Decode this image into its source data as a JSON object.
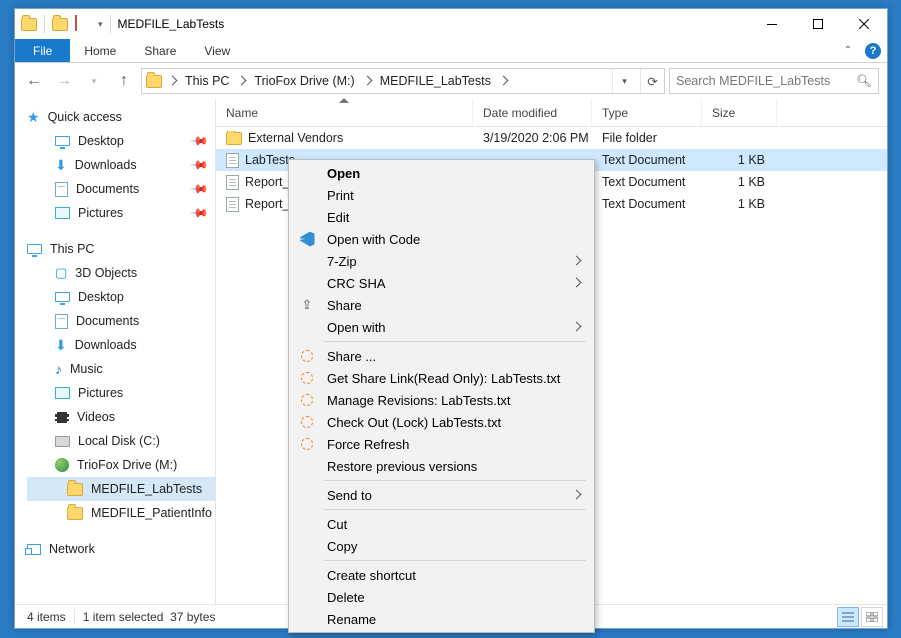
{
  "title": "MEDFILE_LabTests",
  "ribbon": {
    "file": "File",
    "home": "Home",
    "share": "Share",
    "view": "View"
  },
  "breadcrumbs": [
    "This PC",
    "TrioFox Drive (M:)",
    "MEDFILE_LabTests"
  ],
  "search_placeholder": "Search MEDFILE_LabTests",
  "columns": {
    "name": "Name",
    "date": "Date modified",
    "type": "Type",
    "size": "Size"
  },
  "sidebar": {
    "quick": "Quick access",
    "desktop": "Desktop",
    "downloads": "Downloads",
    "documents": "Documents",
    "pictures": "Pictures",
    "thispc": "This PC",
    "threed": "3D Objects",
    "desktop2": "Desktop",
    "documents2": "Documents",
    "downloads2": "Downloads",
    "music": "Music",
    "pictures2": "Pictures",
    "videos": "Videos",
    "localc": "Local Disk (C:)",
    "triofox": "TrioFox Drive (M:)",
    "medlab": "MEDFILE_LabTests",
    "medpat": "MEDFILE_PatientInfo",
    "network": "Network"
  },
  "files": [
    {
      "name": "External Vendors",
      "date": "3/19/2020 2:06 PM",
      "type": "File folder",
      "size": ""
    },
    {
      "name": "LabTests",
      "date": "",
      "type": "Text Document",
      "size": "1 KB"
    },
    {
      "name": "Report_",
      "date": "",
      "type": "Text Document",
      "size": "1 KB"
    },
    {
      "name": "Report_",
      "date": "",
      "type": "Text Document",
      "size": "1 KB"
    }
  ],
  "status": {
    "items": "4 items",
    "selected": "1 item selected",
    "bytes": "37 bytes"
  },
  "menu": {
    "open": "Open",
    "print": "Print",
    "edit": "Edit",
    "openwithcode": "Open with Code",
    "sevenzip": "7-Zip",
    "crcsha": "CRC SHA",
    "share": "Share",
    "openwith": "Open with",
    "sharedots": "Share ...",
    "getsharelink": "Get Share Link(Read Only): LabTests.txt",
    "managerev": "Manage Revisions: LabTests.txt",
    "checkout": "Check Out (Lock) LabTests.txt",
    "forcerefresh": "Force Refresh",
    "restore": "Restore previous versions",
    "sendto": "Send to",
    "cut": "Cut",
    "copy": "Copy",
    "shortcut": "Create shortcut",
    "delete": "Delete",
    "rename": "Rename"
  }
}
